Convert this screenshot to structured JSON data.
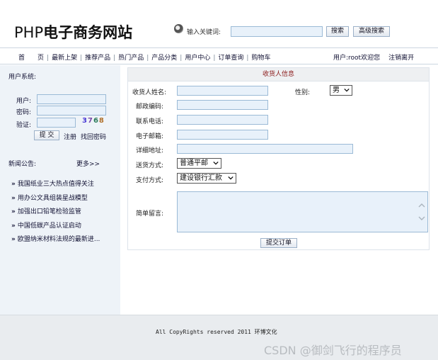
{
  "header": {
    "logo_php": "PHP",
    "logo_text": "电子商务网站",
    "search_label": "输入关键词:",
    "search_value": "",
    "search_button": "搜索",
    "advanced_search_button": "高级搜索"
  },
  "nav": {
    "items": [
      "首　　页",
      "最新上架",
      "推荐产品",
      "热门产品",
      "产品分类",
      "用户中心",
      "订单查询",
      "购物车"
    ],
    "user_text": "用户:root欢迎您",
    "logout": "注销离开"
  },
  "sidebar": {
    "title": "用户系统:",
    "user_label": "用户:",
    "password_label": "密码:",
    "verify_label": "验证:",
    "captcha": [
      "3",
      "7",
      "6",
      "8"
    ],
    "submit_button": "提 交",
    "register_link": "注册",
    "forgot_link": "找回密码",
    "news_title": "新闻公告:",
    "news_more": "更多>>",
    "news_bullet": "»",
    "news_items": [
      "我国纸业三大热点值得关注",
      "用办公文具组装星战模型",
      "加强出口铅笔检验监管",
      "中国低碳产品认证启动",
      "欧盟纳米材料法规的最新进..."
    ]
  },
  "form": {
    "title": "收货人信息",
    "name_label": "收货人姓名:",
    "gender_label": "性别:",
    "gender_value": "男",
    "zip_label": "邮政编码:",
    "phone_label": "联系电话:",
    "email_label": "电子邮箱:",
    "address_label": "详细地址:",
    "shipping_label": "送货方式:",
    "shipping_value": "普通平邮",
    "payment_label": "支付方式:",
    "payment_value": "建设银行汇款",
    "message_label": "简单留言:",
    "submit_order_button": "提交订单"
  },
  "footer": {
    "copyright": "All CopyRights reserved 2011 环博文化",
    "watermark": "CSDN @御剑飞行的程序员"
  }
}
